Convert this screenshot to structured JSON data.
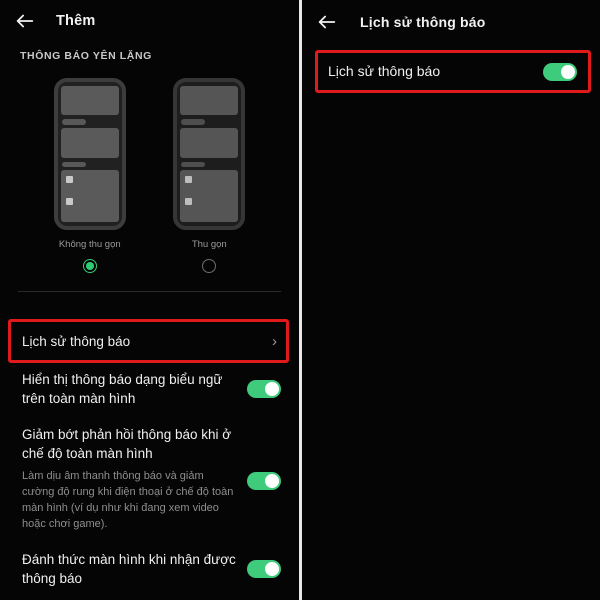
{
  "left_panel": {
    "appbar": {
      "back_icon": "arrow-left-icon",
      "title": "Thêm"
    },
    "section_header": "THÔNG BÁO YÊN LẶNG",
    "mockups": [
      {
        "label": "Không thu gọn",
        "selected": true
      },
      {
        "label": "Thu gọn",
        "selected": false
      }
    ],
    "rows": [
      {
        "title": "Lịch sử thông báo",
        "control": "chevron",
        "chevron_glyph": "›",
        "highlighted": true
      },
      {
        "title": "Hiển thị thông báo dạng biểu ngữ trên toàn màn hình",
        "control": "toggle",
        "toggle_on": true
      },
      {
        "title": "Giảm bớt phản hồi thông báo khi ở chế độ toàn màn hình",
        "desc": "Làm dịu âm thanh thông báo và giảm cường độ rung khi điện thoại ở chế độ toàn màn hình (ví dụ như khi đang xem video hoặc chơi game).",
        "control": "toggle",
        "toggle_on": true
      },
      {
        "title": "Đánh thức màn hình khi nhận được thông báo",
        "control": "toggle",
        "toggle_on": true
      }
    ]
  },
  "right_panel": {
    "appbar": {
      "back_icon": "arrow-left-icon",
      "title": "Lịch sử thông báo"
    },
    "row": {
      "title": "Lịch sử thông báo",
      "control": "toggle",
      "toggle_on": true,
      "highlighted": true
    }
  },
  "colors": {
    "background": "#050505",
    "toggle_on": "#3fcb7c",
    "radio_selected": "#2ecf74",
    "highlight_border": "#e01a1a",
    "primary_text": "#f0f0f0",
    "secondary_text": "#8e8e8e",
    "panel_divider": "#e8e8e8"
  }
}
